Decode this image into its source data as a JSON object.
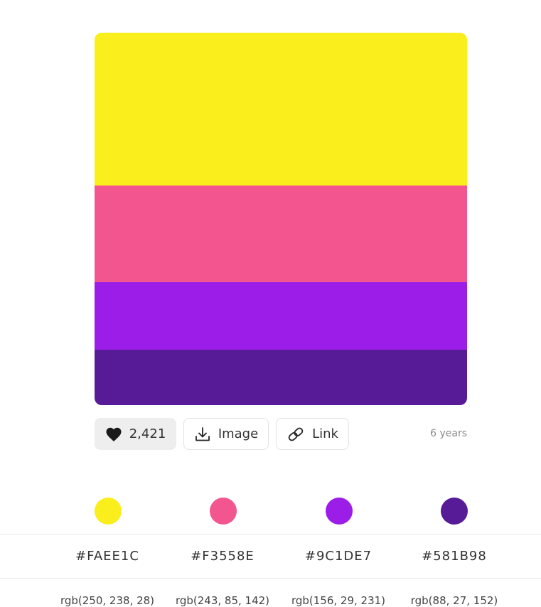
{
  "palette": {
    "colors": [
      {
        "hex": "#FAEE1C",
        "rgb": "rgb(250, 238, 28)",
        "swatch_color": "#FAEE1C"
      },
      {
        "hex": "#F3558E",
        "rgb": "rgb(243, 85, 142)",
        "swatch_color": "#F3558E"
      },
      {
        "hex": "#9C1DE7",
        "rgb": "rgb(156, 29, 231)",
        "swatch_color": "#9C1DE7"
      },
      {
        "hex": "#581B98",
        "rgb": "rgb(88, 27, 152)",
        "swatch_color": "#581B98"
      }
    ]
  },
  "actions": {
    "likes": "2,421",
    "image_label": "Image",
    "link_label": "Link",
    "age": "6 years",
    "like_icon": "heart-icon",
    "image_icon": "download-icon",
    "link_icon": "link-icon"
  }
}
